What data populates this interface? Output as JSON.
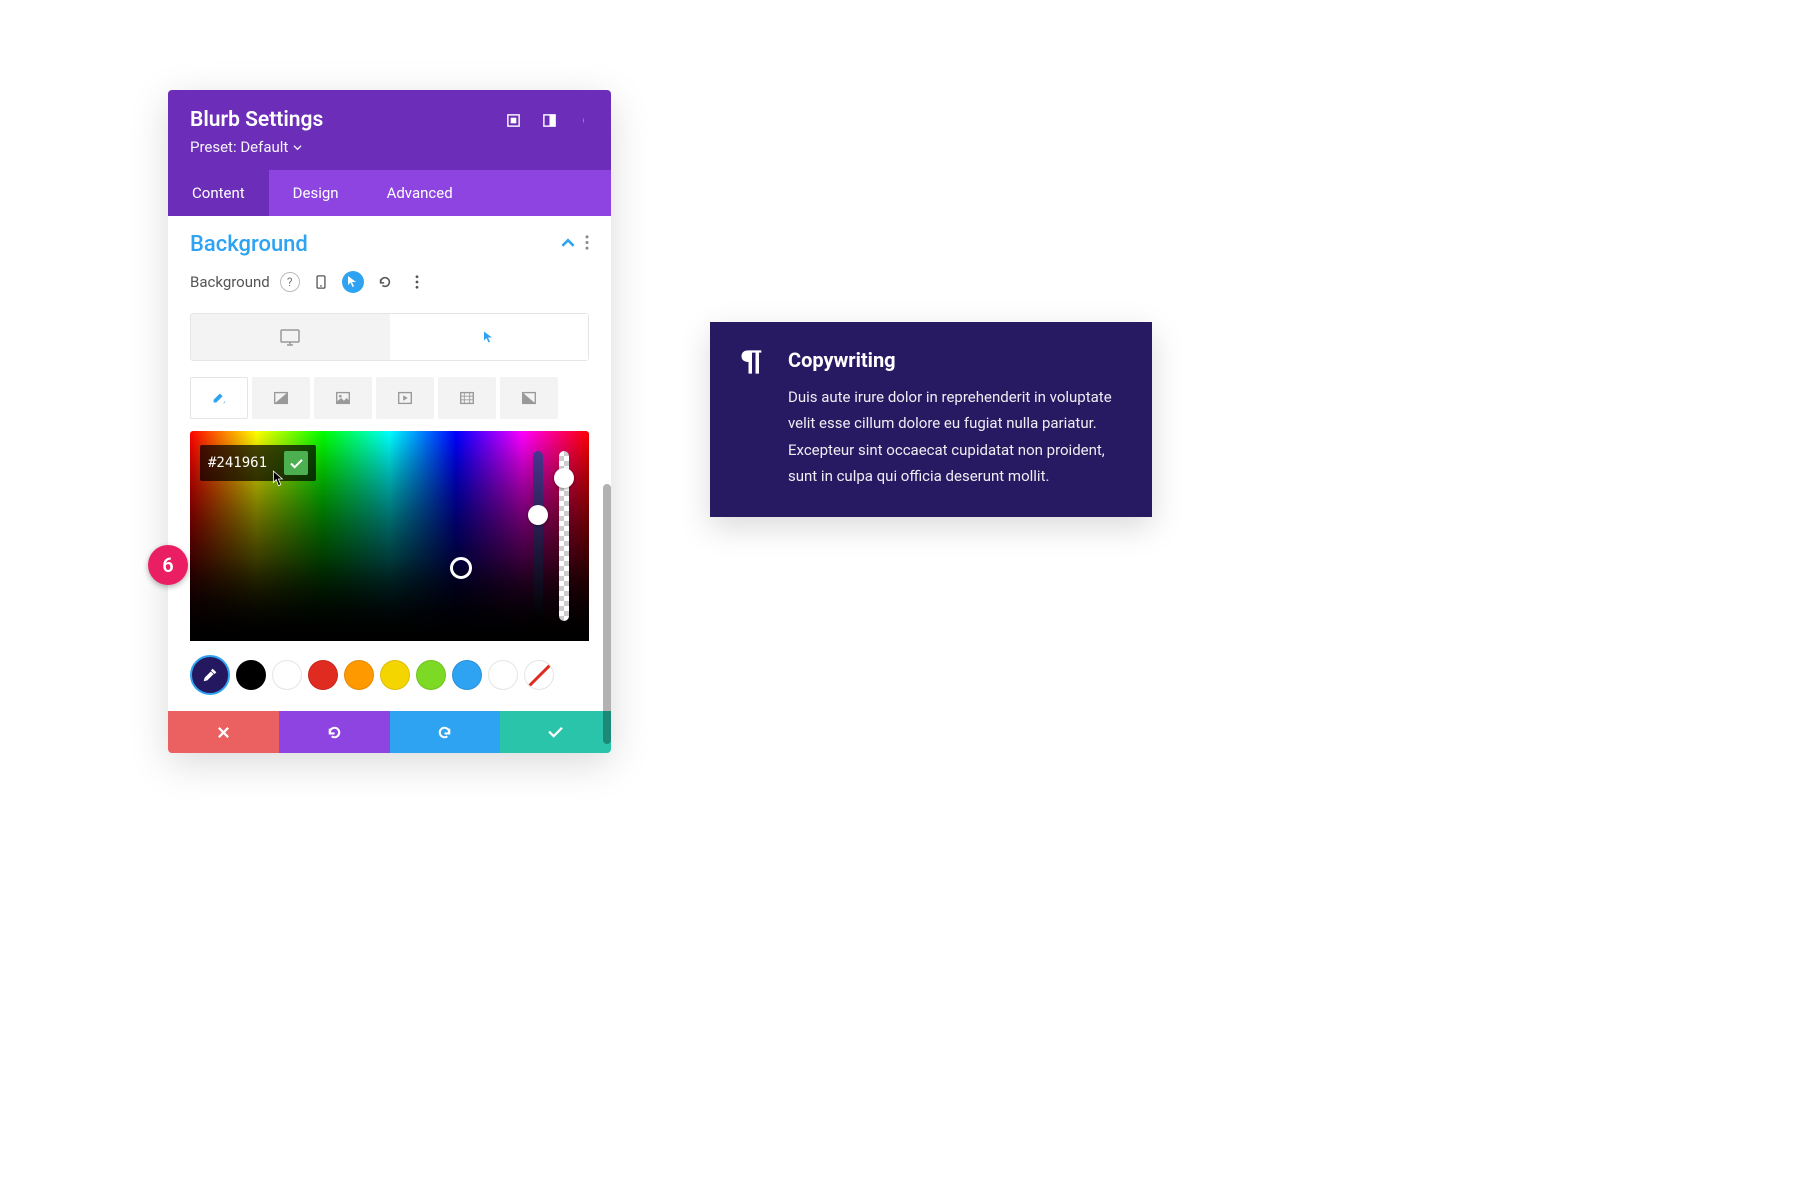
{
  "panel": {
    "title": "Blurb Settings",
    "preset": "Preset: Default"
  },
  "tabs": [
    "Content",
    "Design",
    "Advanced"
  ],
  "section": {
    "title": "Background",
    "field_label": "Background"
  },
  "hex_value": "#241961",
  "step_number": "6",
  "swatch_eyedropper": "#241961",
  "swatch_colors": [
    "#000000",
    "#ffffff",
    "#e02b20",
    "#ff9900",
    "#f5d500",
    "#7cda24",
    "#2ea3f2",
    "#ffffff"
  ],
  "preview": {
    "heading": "Copywriting",
    "body": "Duis aute irure dolor in reprehenderit in voluptate velit esse cillum dolore eu fugiat nulla pariatur. Excepteur sint occaecat cupidatat non proident, sunt in culpa qui officia deserunt mollit.",
    "bg": "#281a62"
  }
}
